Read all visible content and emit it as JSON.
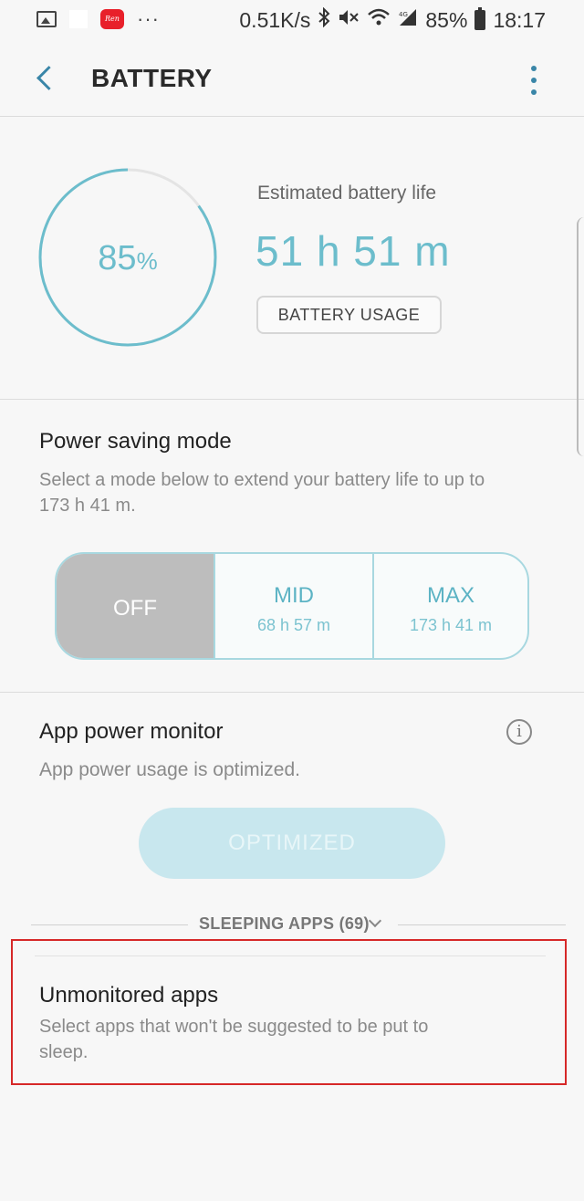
{
  "status_bar": {
    "speed": "0.51K/s",
    "battery": "85%",
    "time": "18:17",
    "icons": [
      "gallery-icon",
      "app-notification-icon",
      "more-notifications-icon",
      "bluetooth-icon",
      "mute-icon",
      "wifi-icon",
      "signal-icon",
      "battery-icon"
    ]
  },
  "header": {
    "title": "BATTERY"
  },
  "battery": {
    "percent": "85",
    "percent_symbol": "%",
    "level_fraction": 0.85,
    "estimated_label": "Estimated battery life",
    "estimated_time": "51 h 51 m",
    "usage_button": "BATTERY USAGE"
  },
  "power_saving": {
    "title": "Power saving mode",
    "description": "Select a mode below to extend your battery life to up to 173 h 41 m.",
    "modes": [
      {
        "label": "OFF",
        "time": ""
      },
      {
        "label": "MID",
        "time": "68 h 57 m"
      },
      {
        "label": "MAX",
        "time": "173 h 41 m"
      }
    ],
    "selected": "OFF"
  },
  "app_power_monitor": {
    "title": "App power monitor",
    "description": "App power usage is optimized.",
    "button": "OPTIMIZED"
  },
  "sleeping_apps": {
    "label": "SLEEPING APPS (69)"
  },
  "unmonitored": {
    "title": "Unmonitored apps",
    "description": "Select apps that won't be suggested to be put to sleep."
  },
  "colors": {
    "accent": "#6cbdcc",
    "highlight_border": "#d62828"
  }
}
